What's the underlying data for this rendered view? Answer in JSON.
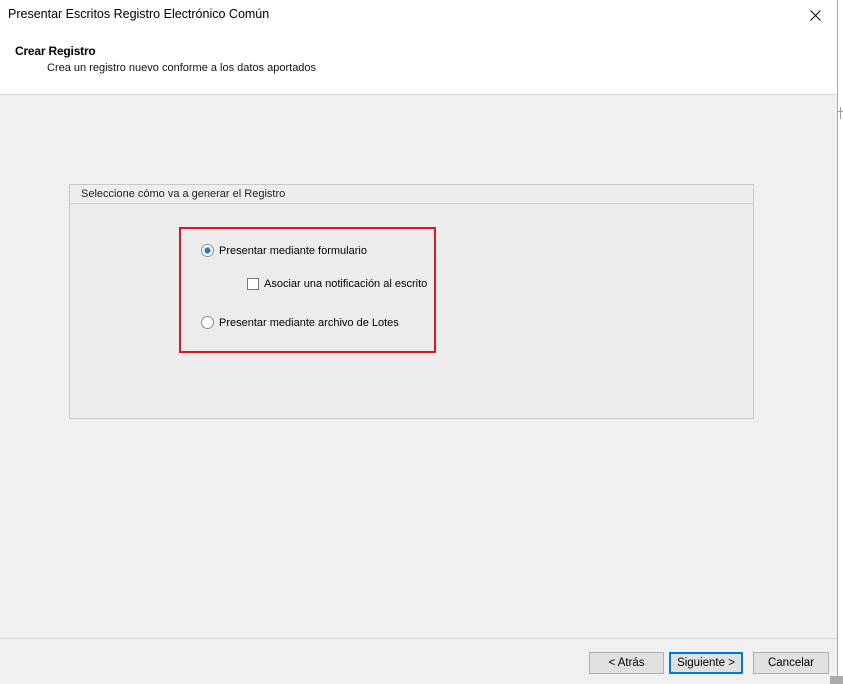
{
  "window": {
    "title": "Presentar Escritos Registro Electrónico Común"
  },
  "header": {
    "title": "Crear Registro",
    "subtitle": "Crea un registro nuevo conforme a los datos aportados"
  },
  "group": {
    "title": "Seleccione cómo va a generar el Registro",
    "options": [
      {
        "label": "Presentar mediante formulario",
        "type": "radio",
        "checked": true
      },
      {
        "label": "Asociar una notificación al escrito",
        "type": "checkbox",
        "checked": false
      },
      {
        "label": "Presentar mediante archivo de Lotes",
        "type": "radio",
        "checked": false
      }
    ]
  },
  "buttons": {
    "back": "< Atrás",
    "next": "Siguiente >",
    "cancel": "Cancelar"
  },
  "colors": {
    "highlight": "#e0141c",
    "accent": "#0078d7"
  },
  "icons": {
    "close": "close-icon"
  }
}
